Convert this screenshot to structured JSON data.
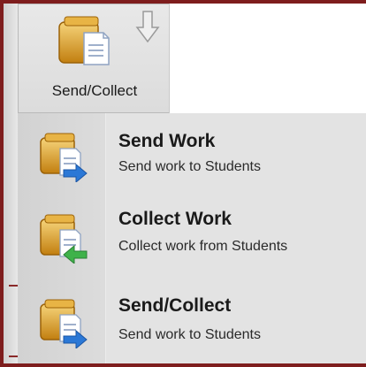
{
  "ribbon": {
    "button": {
      "label": "Send/Collect",
      "icon": "send-collect-icon"
    },
    "dropdown_icon": "arrow-down-icon"
  },
  "menu": {
    "items": [
      {
        "title": "Send Work",
        "description": "Send work to Students",
        "icon": "send-work-icon"
      },
      {
        "title": "Collect Work",
        "description": "Collect work from Students",
        "icon": "collect-work-icon"
      },
      {
        "title": "Send/Collect",
        "description": "Send work to Students",
        "icon": "send-collect-icon"
      }
    ]
  },
  "colors": {
    "frame": "#7e1d1d",
    "folder_gold": "#d99a1a",
    "send_arrow_blue": "#2b78d6",
    "collect_arrow_green": "#3fb24a",
    "menu_bg": "#e3e3e3"
  }
}
